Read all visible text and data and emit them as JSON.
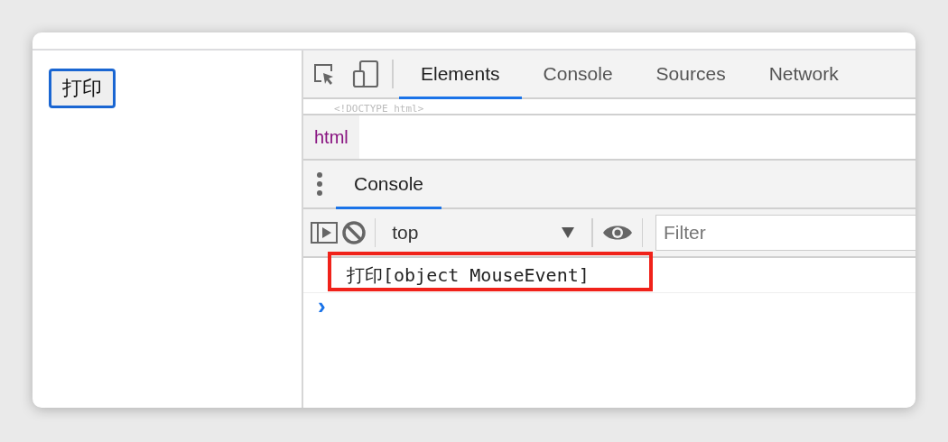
{
  "page": {
    "print_button": "打印"
  },
  "devtools": {
    "tabs": [
      {
        "label": "Elements",
        "selected": true
      },
      {
        "label": "Console",
        "selected": false
      },
      {
        "label": "Sources",
        "selected": false
      },
      {
        "label": "Network",
        "selected": false
      }
    ],
    "dom_line": "<!DOCTYPE html>",
    "breadcrumb": "html",
    "drawer_tabs": [
      {
        "label": "Console",
        "selected": true
      }
    ],
    "context": "top",
    "filter_placeholder": "Filter",
    "log_message": "打印[object MouseEvent]",
    "prompt": "›"
  }
}
